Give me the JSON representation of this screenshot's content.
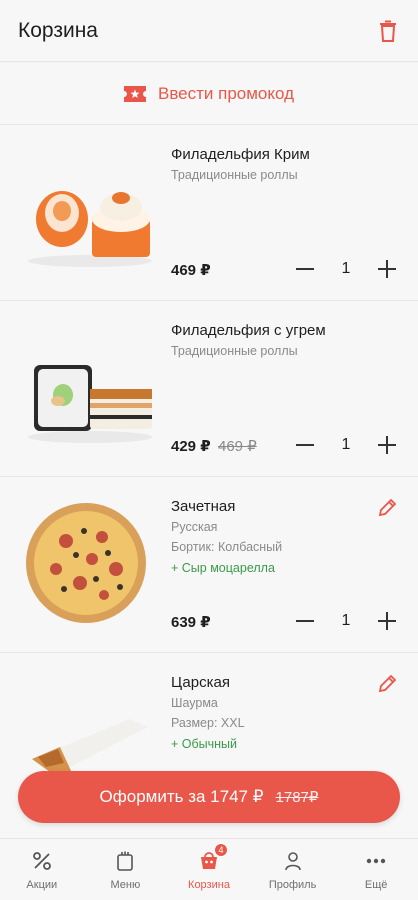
{
  "header": {
    "title": "Корзина"
  },
  "promo": {
    "label": "Ввести промокод"
  },
  "items": [
    {
      "name": "Филадельфия Крим",
      "category": "Традиционные роллы",
      "price": "469 ₽",
      "old_price": "",
      "quantity": "1"
    },
    {
      "name": "Филадельфия с угрем",
      "category": "Традиционные роллы",
      "price": "429 ₽",
      "old_price": "469 ₽",
      "quantity": "1"
    },
    {
      "name": "Зачетная",
      "category": "Русская",
      "option": "Бортик: Колбасный",
      "addon": "+ Сыр моцарелла",
      "price": "639 ₽",
      "quantity": "1"
    },
    {
      "name": "Царская",
      "category": "Шаурма",
      "option": "Размер: XXL",
      "addon": "+ Обычный"
    }
  ],
  "checkout": {
    "label": "Оформить за 1747 ₽",
    "old_total": "1787₽"
  },
  "tabbar": {
    "tabs": [
      {
        "label": "Акции",
        "icon": "percent-icon"
      },
      {
        "label": "Меню",
        "icon": "menu-icon"
      },
      {
        "label": "Корзина",
        "icon": "cart-icon",
        "badge": "4",
        "active": true
      },
      {
        "label": "Профиль",
        "icon": "profile-icon"
      },
      {
        "label": "Ещё",
        "icon": "more-icon"
      }
    ]
  },
  "colors": {
    "accent": "#e8574a",
    "addon": "#3a9a4a",
    "muted": "#8a8a8a"
  }
}
